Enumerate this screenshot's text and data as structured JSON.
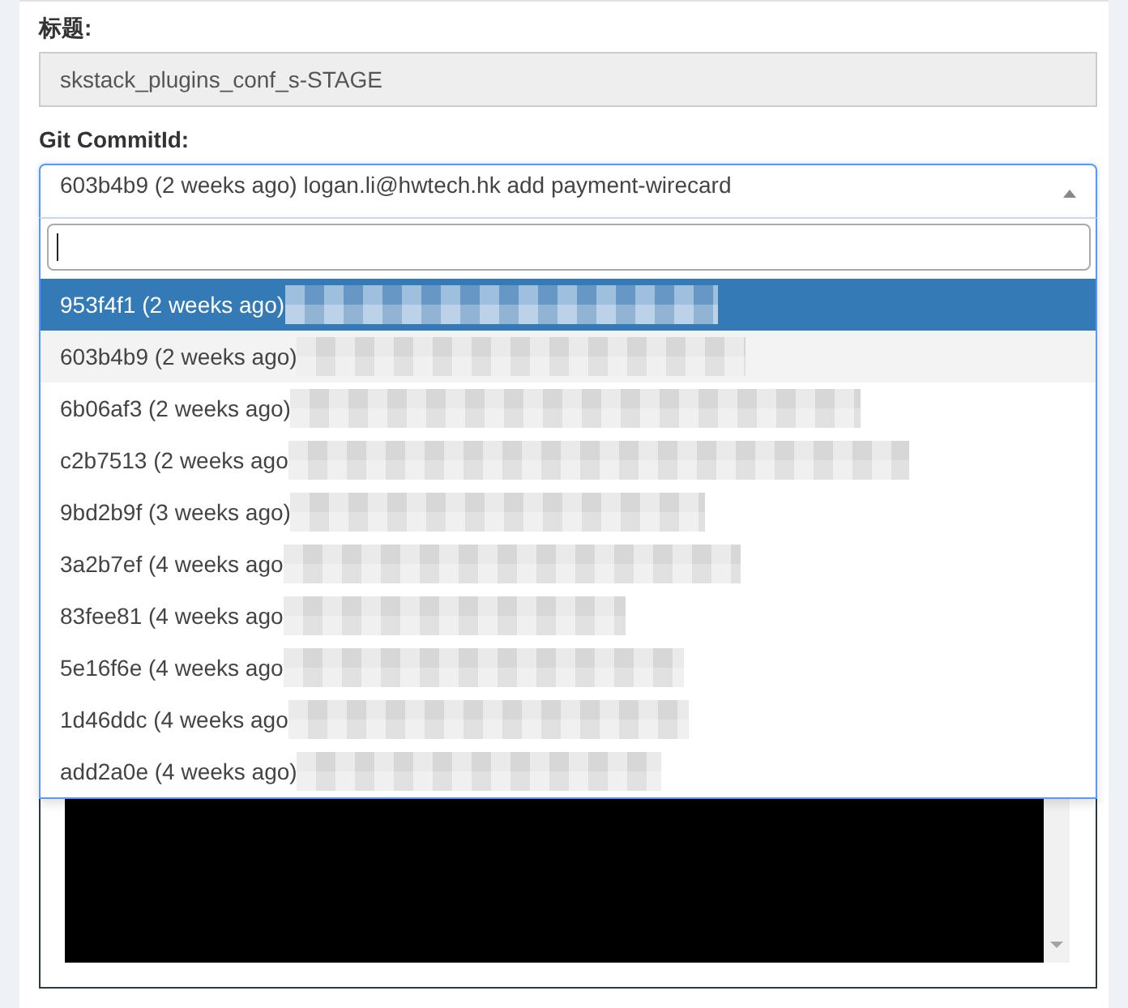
{
  "title_field": {
    "label": "标题:",
    "value": "skstack_plugins_conf_s-STAGE",
    "disabled": true
  },
  "commit_select": {
    "label": "Git CommitId:",
    "value": "603b4b9 (2 weeks ago) logan.li@hwtech.hk add payment-wirecard",
    "expanded": true,
    "search": {
      "focused": true
    },
    "options": [
      {
        "text": "953f4f1 (2 weeks ago)",
        "highlighted": true,
        "selected": false
      },
      {
        "text": "603b4b9 (2 weeks ago)",
        "highlighted": false,
        "selected": true
      },
      {
        "text": "6b06af3 (2 weeks ago)",
        "highlighted": false,
        "selected": false
      },
      {
        "text": "c2b7513 (2 weeks ago",
        "highlighted": false,
        "selected": false
      },
      {
        "text": "9bd2b9f (3 weeks ago)",
        "highlighted": false,
        "selected": false
      },
      {
        "text": "3a2b7ef (4 weeks ago",
        "highlighted": false,
        "selected": false
      },
      {
        "text": "83fee81 (4 weeks ago",
        "highlighted": false,
        "selected": false
      },
      {
        "text": "5e16f6e (4 weeks ago",
        "highlighted": false,
        "selected": false
      },
      {
        "text": "1d46ddc (4 weeks ago",
        "highlighted": false,
        "selected": false
      },
      {
        "text": "add2a0e (4 weeks ago)",
        "highlighted": false,
        "selected": false
      }
    ]
  }
}
